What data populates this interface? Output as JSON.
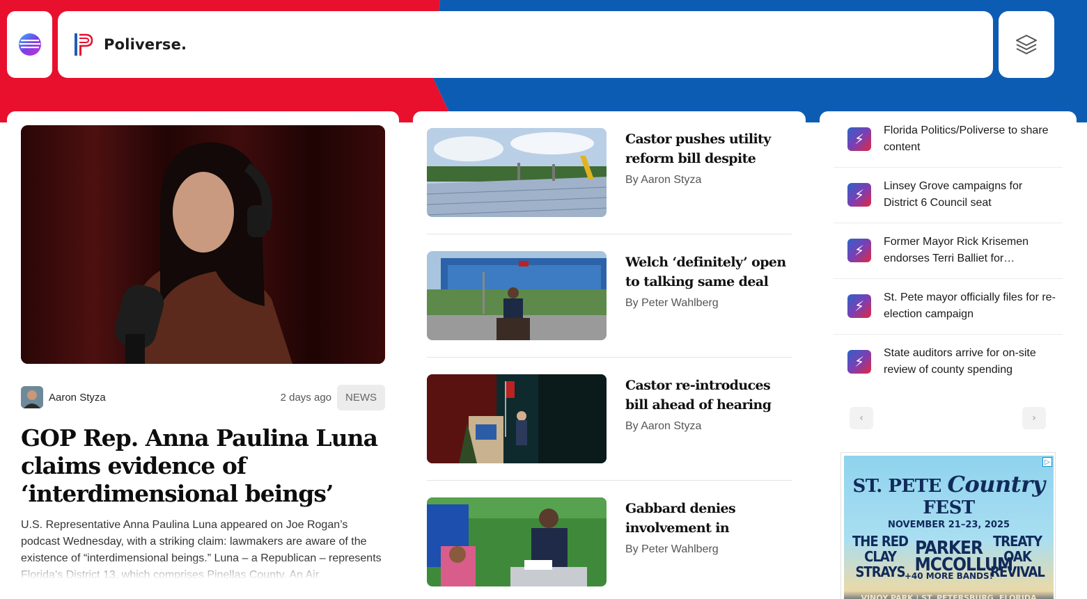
{
  "header": {
    "brand_name": "Poliverse.",
    "app_icon": "orb-logo-icon",
    "brand_icon": "poliverse-p-logo-icon",
    "layers_icon": "layers-icon"
  },
  "colors": {
    "red": "#e8102d",
    "blue": "#0d5cb3",
    "brief_icon_gradient": [
      "#2d63c8",
      "#e3273f"
    ]
  },
  "featured": {
    "author": "Aaron Styza",
    "time_ago": "2 days ago",
    "category": "NEWS",
    "title": "GOP Rep. Anna Paulina Luna claims evidence of ‘interdimensional beings’",
    "excerpt": "U.S. Representative Anna Paulina Luna appeared on Joe Rogan’s podcast Wednesday, with a striking claim: lawmakers are aware of the existence of “interdimensional beings.” Luna – a Republican – represents Florida’s District 13, which comprises Pinellas County. An Air"
  },
  "stories": [
    {
      "title": "Castor pushes utility reform bill despite FPL…",
      "author": "By Aaron Styza"
    },
    {
      "title": "Welch ‘definitely’ open to talking same deal with…",
      "author": "By Peter Wahlberg"
    },
    {
      "title": "Castor re-introduces bill ahead of hearing on…",
      "author": "By Aaron Styza"
    },
    {
      "title": "Gabbard denies involvement in mystery…",
      "author": "By Peter Wahlberg"
    }
  ],
  "briefs": [
    {
      "text": "Florida Politics/Poliverse to share content",
      "icon": "lightning-bolt-icon"
    },
    {
      "text": "Linsey Grove campaigns for District 6 Council seat",
      "icon": "lightning-bolt-icon"
    },
    {
      "text": "Former Mayor Rick Krisemen endorses Terri Balliet for…",
      "icon": "lightning-bolt-icon"
    },
    {
      "text": "St. Pete mayor officially files for re-election campaign",
      "icon": "lightning-bolt-icon"
    },
    {
      "text": "State auditors arrive for on-site review of county spending",
      "icon": "lightning-bolt-icon"
    }
  ],
  "carousel": {
    "prev": "‹",
    "next": "›"
  },
  "ad": {
    "headline_left": "ST. PETE",
    "headline_script": "Country",
    "headline_right": "FEST",
    "dates": "NOVEMBER 21–23, 2025",
    "acts": [
      "THE RED CLAY STRAYS",
      "PARKER MCCOLLUM",
      "TREATY OAK REVIVAL"
    ],
    "more": "+40 MORE BANDS!",
    "venue": "VINOY PARK | ST. PETERSBURG, FLORIDA",
    "adchoices": "▷"
  }
}
